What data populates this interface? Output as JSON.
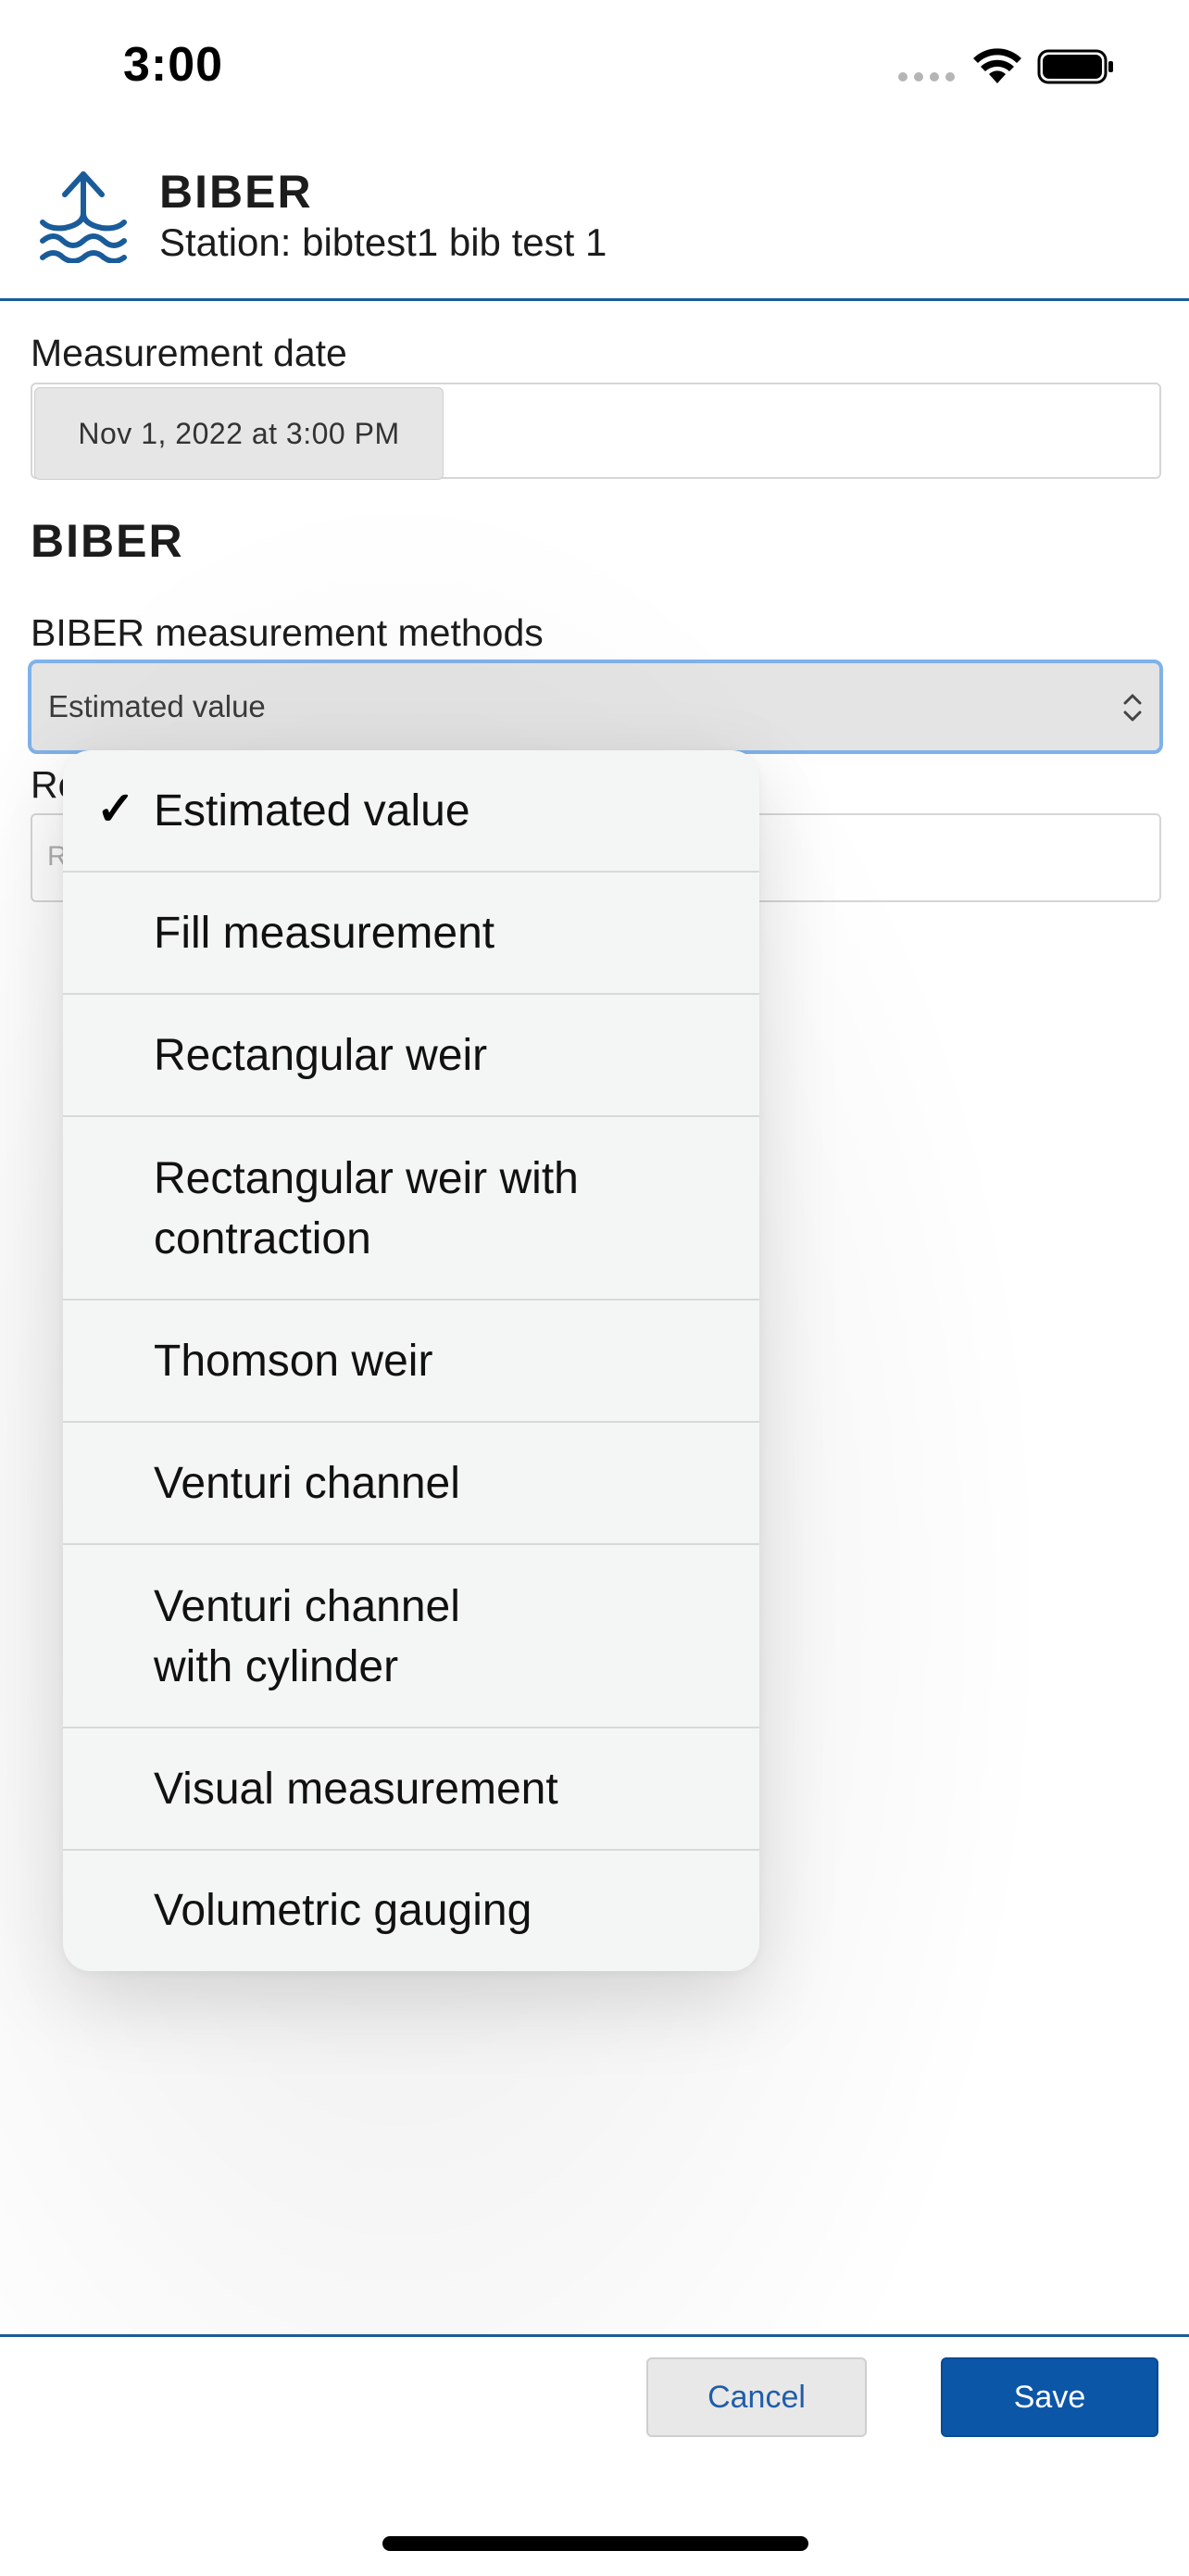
{
  "status_bar": {
    "time": "3:00"
  },
  "header": {
    "title": "BIBER",
    "station": "Station: bibtest1 bib test 1",
    "brand_color": "#1a5c9a"
  },
  "form": {
    "date_label": "Measurement date",
    "date_value": "Nov 1, 2022 at 3:00 PM",
    "section_title": "BIBER",
    "method_label": "BIBER measurement methods",
    "method_value": "Estimated value",
    "next_label_partial": "Re",
    "next_placeholder_partial": "R"
  },
  "dropdown": {
    "selected_index": 0,
    "options": [
      "Estimated value",
      "Fill measurement",
      "Rectangular weir",
      "Rectangular weir with contraction",
      "Thomson weir",
      "Venturi channel",
      "Venturi channel with cylinder",
      "Visual measurement",
      "Volumetric gauging"
    ],
    "option_lines": [
      [
        "Estimated value"
      ],
      [
        "Fill measurement"
      ],
      [
        "Rectangular weir"
      ],
      [
        "Rectangular weir with",
        "contraction"
      ],
      [
        "Thomson weir"
      ],
      [
        "Venturi channel"
      ],
      [
        "Venturi channel",
        "with cylinder"
      ],
      [
        "Visual measurement"
      ],
      [
        "Volumetric gauging"
      ]
    ]
  },
  "footer": {
    "cancel_label": "Cancel",
    "save_label": "Save",
    "accent_color": "#0c56a8"
  }
}
